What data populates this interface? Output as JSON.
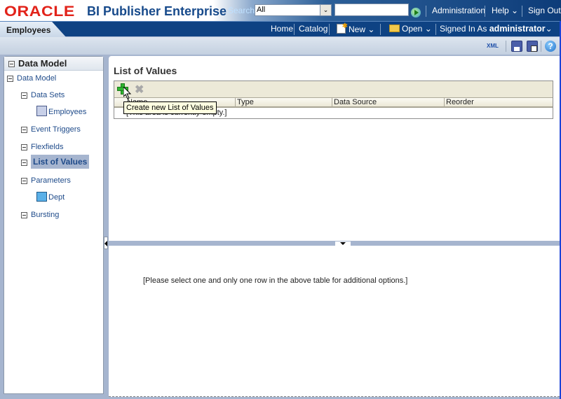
{
  "header": {
    "brand": "ORACLE",
    "app_title": "BI Publisher Enterprise",
    "search_label": "Search",
    "search_scope": "All",
    "search_query": "",
    "links": [
      "Administration",
      "Help",
      "Sign Out"
    ]
  },
  "nav": {
    "active_tab": "Employees",
    "links": [
      "Home",
      "Catalog",
      "New",
      "Open"
    ],
    "signed_in_label": "Signed In As",
    "user": "administrator"
  },
  "toolbar_icons": [
    "xml-icon",
    "save-icon",
    "save-as-icon",
    "help-icon"
  ],
  "left_panel": {
    "title": "Data Model",
    "tree": [
      {
        "label": "Data Model",
        "level": 0
      },
      {
        "label": "Data Sets",
        "level": 1
      },
      {
        "label": "Employees",
        "level": 2
      },
      {
        "label": "Event Triggers",
        "level": 1
      },
      {
        "label": "Flexfields",
        "level": 1
      },
      {
        "label": "List of Values",
        "level": 1,
        "selected": true
      },
      {
        "label": "Parameters",
        "level": 1
      },
      {
        "label": "Dept",
        "level": 2
      },
      {
        "label": "Bursting",
        "level": 1
      }
    ]
  },
  "main": {
    "title": "List of Values",
    "columns": [
      "Name",
      "Type",
      "Data Source",
      "Reorder"
    ],
    "empty_text": "[This area is currently empty.]",
    "tooltip": "Create new List of Values",
    "detail_message": "[Please select one and only one row in the above table for additional options.]"
  }
}
